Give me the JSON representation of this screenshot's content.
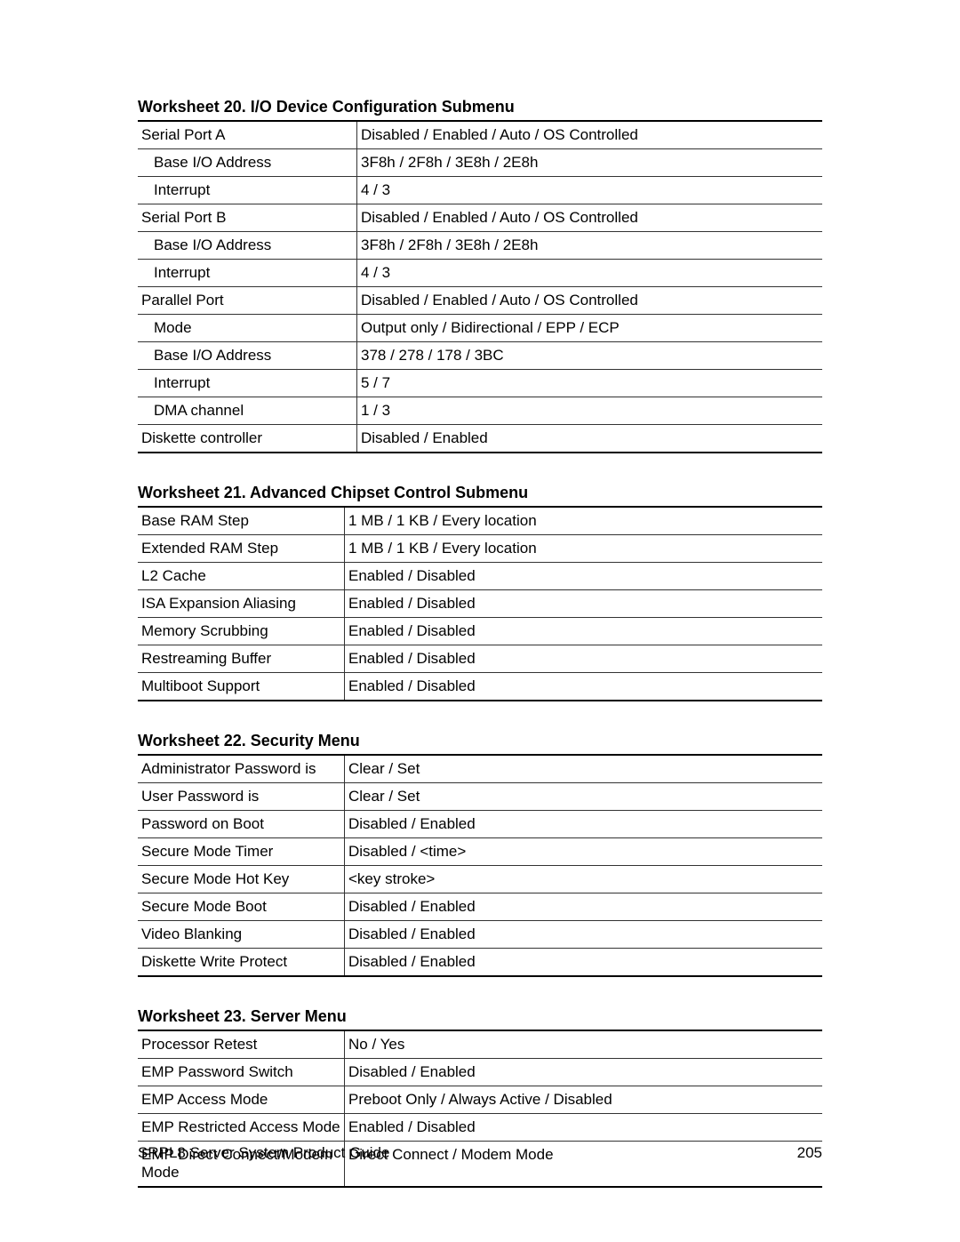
{
  "tables": [
    {
      "title": "Worksheet 20.  I/O Device Configuration Submenu",
      "rows": [
        {
          "label": "Serial Port A",
          "value": "Disabled  /  Enabled  /  Auto  /  OS Controlled",
          "indent": false
        },
        {
          "label": "Base I/O Address",
          "value": "3F8h  /  2F8h  /  3E8h  /  2E8h",
          "indent": true
        },
        {
          "label": "Interrupt",
          "value": "4  /  3",
          "indent": true
        },
        {
          "label": "Serial Port B",
          "value": "Disabled  /  Enabled  /  Auto  /  OS Controlled",
          "indent": false
        },
        {
          "label": "Base I/O Address",
          "value": "3F8h  /  2F8h  /  3E8h  /  2E8h",
          "indent": true
        },
        {
          "label": "Interrupt",
          "value": "4  /  3",
          "indent": true
        },
        {
          "label": "Parallel Port",
          "value": "Disabled  /  Enabled  /  Auto  /  OS Controlled",
          "indent": false
        },
        {
          "label": "Mode",
          "value": "Output only  /  Bidirectional  /  EPP  /  ECP",
          "indent": true
        },
        {
          "label": "Base I/O Address",
          "value": "378  /  278  /  178  /  3BC",
          "indent": true
        },
        {
          "label": "Interrupt",
          "value": "5  /  7",
          "indent": true
        },
        {
          "label": "DMA channel",
          "value": "1  /  3",
          "indent": true
        },
        {
          "label": "Diskette controller",
          "value": "Disabled  /  Enabled",
          "indent": false
        }
      ]
    },
    {
      "title": "Worksheet 21.  Advanced Chipset Control Submenu",
      "rows": [
        {
          "label": "Base RAM Step",
          "value": "1 MB  /  1 KB  /  Every location",
          "indent": false
        },
        {
          "label": "Extended RAM Step",
          "value": "1 MB  /  1 KB  /  Every location",
          "indent": false
        },
        {
          "label": "L2 Cache",
          "value": "Enabled  /  Disabled",
          "indent": false
        },
        {
          "label": "ISA Expansion Aliasing",
          "value": "Enabled  /  Disabled",
          "indent": false
        },
        {
          "label": "Memory Scrubbing",
          "value": "Enabled  /  Disabled",
          "indent": false
        },
        {
          "label": "Restreaming Buffer",
          "value": "Enabled  /  Disabled",
          "indent": false
        },
        {
          "label": "Multiboot Support",
          "value": "Enabled  /  Disabled",
          "indent": false
        }
      ]
    },
    {
      "title": "Worksheet 22.  Security Menu",
      "rows": [
        {
          "label": "Administrator Password is",
          "value": "Clear  /  Set",
          "indent": false
        },
        {
          "label": "User Password is",
          "value": "Clear  /  Set",
          "indent": false
        },
        {
          "label": "Password on Boot",
          "value": "Disabled  /  Enabled",
          "indent": false
        },
        {
          "label": "Secure Mode Timer",
          "value": "Disabled  /  <time>",
          "indent": false
        },
        {
          "label": "Secure Mode Hot Key",
          "value": "<key stroke>",
          "indent": false
        },
        {
          "label": "Secure Mode Boot",
          "value": "Disabled  /  Enabled",
          "indent": false
        },
        {
          "label": "Video Blanking",
          "value": "Disabled  /  Enabled",
          "indent": false
        },
        {
          "label": "Diskette Write Protect",
          "value": "Disabled  /  Enabled",
          "indent": false
        }
      ]
    },
    {
      "title": "Worksheet 23.  Server Menu",
      "rows": [
        {
          "label": "Processor Retest",
          "value": "No  /  Yes",
          "indent": false
        },
        {
          "label": "EMP Password Switch",
          "value": "Disabled  /  Enabled",
          "indent": false
        },
        {
          "label": "EMP Access Mode",
          "value": "Preboot Only  /  Always Active  /  Disabled",
          "indent": false
        },
        {
          "label": "EMP Restricted Access Mode",
          "value": "Enabled  /  Disabled",
          "indent": false
        },
        {
          "label": "EMP Direct Connect/Modem Mode",
          "value": "Direct Connect  /  Modem Mode",
          "indent": false
        }
      ]
    }
  ],
  "footer": {
    "left": "SRPL8 Server System Product Guide",
    "right": "205"
  }
}
